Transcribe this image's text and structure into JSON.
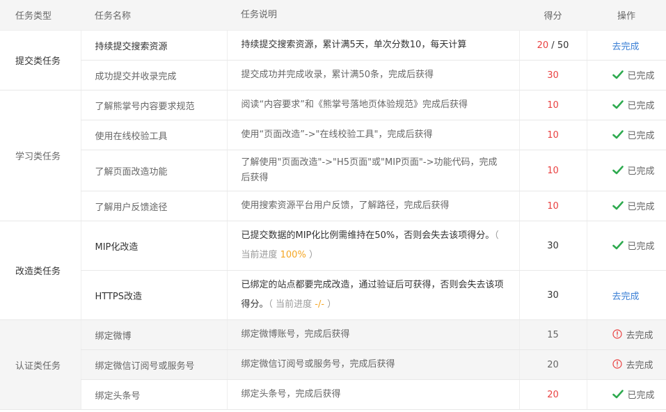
{
  "columns": {
    "type": "任务类型",
    "name": "任务名称",
    "desc": "任务说明",
    "score": "得分",
    "op": "操作"
  },
  "status": {
    "done": "已完成",
    "todo": "去完成"
  },
  "colors": {
    "score_red": "#e94040",
    "check_green": "#2eaa4f",
    "link_blue": "#3a7fd5",
    "progress_orange": "#f5a623",
    "warning_red": "#e94040"
  },
  "groups": [
    {
      "type": "提交类任务",
      "tasks": [
        {
          "name": "持续提交搜索资源",
          "desc": "持续提交搜索资源，累计满5天，单次分数10，每天计算",
          "score_current": "20",
          "score_sep": " / ",
          "score_max": "50",
          "action": "去完成"
        },
        {
          "name": "成功提交并收录完成",
          "desc": "提交成功并完成收录，累计满50条，完成后获得",
          "score": "30",
          "action": "已完成"
        }
      ]
    },
    {
      "type": "学习类任务",
      "tasks": [
        {
          "name": "了解熊掌号内容要求规范",
          "desc": "阅读“内容要求”和《熊掌号落地页体验规范》完成后获得",
          "score": "10",
          "action": "已完成"
        },
        {
          "name": "使用在线校验工具",
          "desc": "使用“页面改造”->\"在线校验工具\"，完成后获得",
          "score": "10",
          "action": "已完成"
        },
        {
          "name": "了解页面改造功能",
          "desc": "了解使用\"页面改造\"->\"H5页面\"或\"MIP页面\"->功能代码，完成后获得",
          "score": "10",
          "action": "已完成"
        },
        {
          "name": "了解用户反馈途径",
          "desc": "使用搜索资源平台用户反馈，了解路径，完成后获得",
          "score": "10",
          "action": "已完成"
        }
      ]
    },
    {
      "type": "改造类任务",
      "tasks": [
        {
          "name": "MIP化改造",
          "desc": "已提交数据的MIP化比例需维持在50%，否则会失去该项得分。",
          "progress_open": "（ 当前进度 ",
          "progress_value": "100%",
          "progress_close": " ）",
          "score": "30",
          "action": "已完成"
        },
        {
          "name": "HTTPS改造",
          "desc": "已绑定的站点都要完成改造，通过验证后可获得，否则会失去该项得分。",
          "progress_open": "（ 当前进度 ",
          "progress_value": "-/-",
          "progress_close": " ）",
          "score": "30",
          "action": "去完成"
        }
      ]
    },
    {
      "type": "认证类任务",
      "tasks": [
        {
          "name": "绑定微博",
          "desc": "绑定微博账号，完成后获得",
          "score": "15",
          "action": "去完成"
        },
        {
          "name": "绑定微信订阅号或服务号",
          "desc": "绑定微信订阅号或服务号，完成后获得",
          "score": "20",
          "action": "去完成"
        },
        {
          "name": "绑定头条号",
          "desc": "绑定头条号，完成后获得",
          "score": "20",
          "action": "已完成"
        }
      ]
    }
  ]
}
